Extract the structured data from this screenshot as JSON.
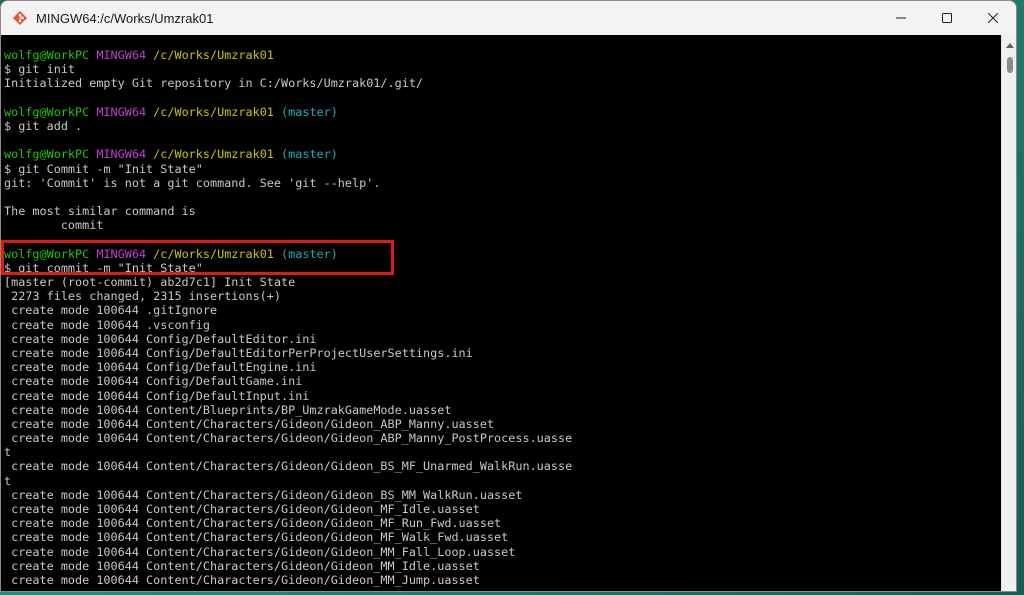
{
  "window": {
    "title": "MINGW64:/c/Works/Umzrak01",
    "controls": {
      "minimize": "—",
      "maximize": "☐",
      "close": "✕"
    }
  },
  "terminal": {
    "lines": [
      {
        "segments": [
          {
            "text": "wolfg@WorkPC",
            "color": "green"
          },
          {
            "text": " "
          },
          {
            "text": "MINGW64",
            "color": "magenta"
          },
          {
            "text": " "
          },
          {
            "text": "/c/Works/Umzrak01",
            "color": "yellow"
          }
        ]
      },
      {
        "segments": [
          {
            "text": "$ git init"
          }
        ]
      },
      {
        "segments": [
          {
            "text": "Initialized empty Git repository in C:/Works/Umzrak01/.git/"
          }
        ]
      },
      {
        "segments": [
          {
            "text": ""
          }
        ]
      },
      {
        "segments": [
          {
            "text": "wolfg@WorkPC",
            "color": "green"
          },
          {
            "text": " "
          },
          {
            "text": "MINGW64",
            "color": "magenta"
          },
          {
            "text": " "
          },
          {
            "text": "/c/Works/Umzrak01",
            "color": "yellow"
          },
          {
            "text": " "
          },
          {
            "text": "(master)",
            "color": "cyan"
          }
        ]
      },
      {
        "segments": [
          {
            "text": "$ git add ."
          }
        ]
      },
      {
        "segments": [
          {
            "text": ""
          }
        ]
      },
      {
        "segments": [
          {
            "text": "wolfg@WorkPC",
            "color": "green"
          },
          {
            "text": " "
          },
          {
            "text": "MINGW64",
            "color": "magenta"
          },
          {
            "text": " "
          },
          {
            "text": "/c/Works/Umzrak01",
            "color": "yellow"
          },
          {
            "text": " "
          },
          {
            "text": "(master)",
            "color": "cyan"
          }
        ]
      },
      {
        "segments": [
          {
            "text": "$ git Commit -m \"Init State\""
          }
        ]
      },
      {
        "segments": [
          {
            "text": "git: 'Commit' is not a git command. See 'git --help'."
          }
        ]
      },
      {
        "segments": [
          {
            "text": ""
          }
        ]
      },
      {
        "segments": [
          {
            "text": "The most similar command is"
          }
        ]
      },
      {
        "segments": [
          {
            "text": "        commit"
          }
        ]
      },
      {
        "segments": [
          {
            "text": ""
          }
        ]
      },
      {
        "segments": [
          {
            "text": "wolfg@WorkPC",
            "color": "green"
          },
          {
            "text": " "
          },
          {
            "text": "MINGW64",
            "color": "magenta"
          },
          {
            "text": " "
          },
          {
            "text": "/c/Works/Umzrak01",
            "color": "yellow"
          },
          {
            "text": " "
          },
          {
            "text": "(master)",
            "color": "cyan"
          }
        ]
      },
      {
        "segments": [
          {
            "text": "$ git commit -m \"Init State\""
          }
        ]
      },
      {
        "segments": [
          {
            "text": "[master (root-commit) ab2d7c1] Init State"
          }
        ]
      },
      {
        "segments": [
          {
            "text": " 2273 files changed, 2315 insertions(+)"
          }
        ]
      },
      {
        "segments": [
          {
            "text": " create mode 100644 .gitIgnore"
          }
        ]
      },
      {
        "segments": [
          {
            "text": " create mode 100644 .vsconfig"
          }
        ]
      },
      {
        "segments": [
          {
            "text": " create mode 100644 Config/DefaultEditor.ini"
          }
        ]
      },
      {
        "segments": [
          {
            "text": " create mode 100644 Config/DefaultEditorPerProjectUserSettings.ini"
          }
        ]
      },
      {
        "segments": [
          {
            "text": " create mode 100644 Config/DefaultEngine.ini"
          }
        ]
      },
      {
        "segments": [
          {
            "text": " create mode 100644 Config/DefaultGame.ini"
          }
        ]
      },
      {
        "segments": [
          {
            "text": " create mode 100644 Config/DefaultInput.ini"
          }
        ]
      },
      {
        "segments": [
          {
            "text": " create mode 100644 Content/Blueprints/BP_UmzrakGameMode.uasset"
          }
        ]
      },
      {
        "segments": [
          {
            "text": " create mode 100644 Content/Characters/Gideon/Gideon_ABP_Manny.uasset"
          }
        ]
      },
      {
        "segments": [
          {
            "text": " create mode 100644 Content/Characters/Gideon/Gideon_ABP_Manny_PostProcess.uasse"
          }
        ]
      },
      {
        "segments": [
          {
            "text": "t"
          }
        ]
      },
      {
        "segments": [
          {
            "text": " create mode 100644 Content/Characters/Gideon/Gideon_BS_MF_Unarmed_WalkRun.uasse"
          }
        ]
      },
      {
        "segments": [
          {
            "text": "t"
          }
        ]
      },
      {
        "segments": [
          {
            "text": " create mode 100644 Content/Characters/Gideon/Gideon_BS_MM_WalkRun.uasset"
          }
        ]
      },
      {
        "segments": [
          {
            "text": " create mode 100644 Content/Characters/Gideon/Gideon_MF_Idle.uasset"
          }
        ]
      },
      {
        "segments": [
          {
            "text": " create mode 100644 Content/Characters/Gideon/Gideon_MF_Run_Fwd.uasset"
          }
        ]
      },
      {
        "segments": [
          {
            "text": " create mode 100644 Content/Characters/Gideon/Gideon_MF_Walk_Fwd.uasset"
          }
        ]
      },
      {
        "segments": [
          {
            "text": " create mode 100644 Content/Characters/Gideon/Gideon_MM_Fall_Loop.uasset"
          }
        ]
      },
      {
        "segments": [
          {
            "text": " create mode 100644 Content/Characters/Gideon/Gideon_MM_Idle.uasset"
          }
        ]
      },
      {
        "segments": [
          {
            "text": " create mode 100644 Content/Characters/Gideon/Gideon_MM_Jump.uasset"
          }
        ]
      }
    ]
  },
  "colors": {
    "background": "#000000",
    "default_text": "#c8c8c8",
    "green": "#21c400",
    "magenta": "#c13fd0",
    "yellow": "#c9c300",
    "cyan": "#18aeb1",
    "highlight_border": "#e01919"
  }
}
